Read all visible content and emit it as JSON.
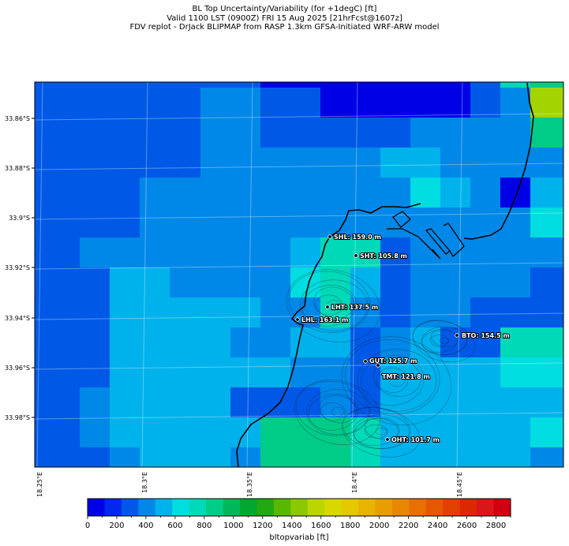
{
  "title": {
    "line1": "BL Top Uncertainty/Variability (for +1degC) [ft]",
    "line2": "Valid 1100 LST (0900Z) FRI 15 Aug 2025 [21hrFcst@1607z]",
    "line3": "FDV replot - DrJack BLIPMAP from RASP 1.3km GFSA-Initiated WRF-ARW model"
  },
  "axes": {
    "lat_ticks": [
      "33.86°S",
      "33.88°S",
      "33.9°S",
      "33.92°S",
      "33.94°S",
      "33.96°S",
      "33.98°S"
    ],
    "lon_ticks": [
      "18.25°E",
      "18.3°E",
      "18.35°E",
      "18.4°E",
      "18.45°E"
    ]
  },
  "colorbar": {
    "label": "bltopvariab [ft]",
    "ticks": [
      "0",
      "200",
      "400",
      "600",
      "800",
      "1000",
      "1200",
      "1400",
      "1600",
      "1800",
      "2000",
      "2200",
      "2400",
      "2600",
      "2800"
    ],
    "colors": [
      "#0000e6",
      "#0029ee",
      "#0059e6",
      "#0088e8",
      "#00b2ec",
      "#00dde0",
      "#00d9b8",
      "#00cc88",
      "#00b85a",
      "#00a830",
      "#22a810",
      "#58b800",
      "#8cc800",
      "#bcd400",
      "#d8d800",
      "#e6c800",
      "#e8b400",
      "#e89e00",
      "#e88800",
      "#e87000",
      "#e45800",
      "#e04000",
      "#dc2800",
      "#d81818",
      "#d00010"
    ],
    "max": 2900
  },
  "stations": [
    {
      "label": "SHL: 159.0 m"
    },
    {
      "label": "SHT: 105.8 m"
    },
    {
      "label": "LHT: 137.5 m"
    },
    {
      "label": "LHL: 163.1 m"
    },
    {
      "label": "BTO: 154.5 m"
    },
    {
      "label": "GUT: 125.7 m"
    },
    {
      "label": "TMT: 121.8 m"
    },
    {
      "label": "OHT: 101.7 m"
    }
  ]
}
